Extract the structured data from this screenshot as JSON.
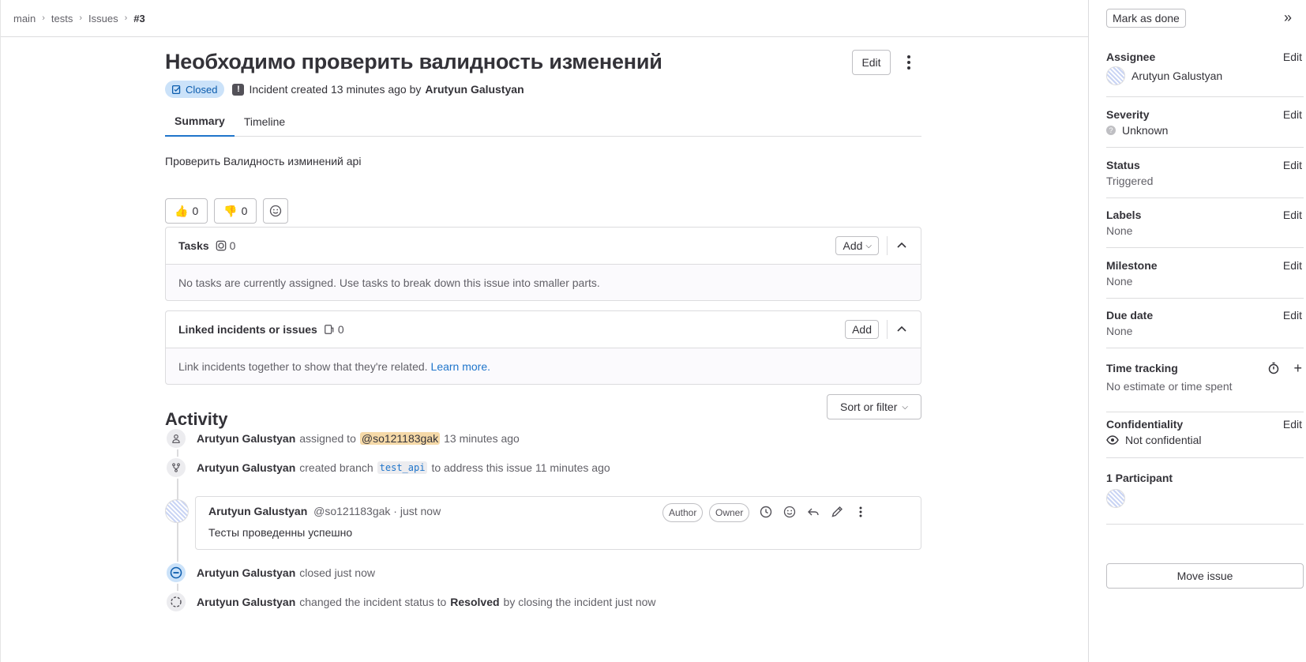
{
  "breadcrumbs": [
    "main",
    "tests",
    "Issues",
    "#3"
  ],
  "issue": {
    "title": "Необходимо проверить валидность изменений",
    "edit_label": "Edit",
    "status_badge": "Closed",
    "meta_text": "Incident created 13 minutes ago by",
    "author": "Arutyun Galustyan",
    "description": "Проверить Валидность изминений api"
  },
  "tabs": [
    {
      "label": "Summary",
      "active": true
    },
    {
      "label": "Timeline",
      "active": false
    }
  ],
  "reactions": {
    "thumbs_up": "0",
    "thumbs_down": "0"
  },
  "tasks": {
    "title": "Tasks",
    "count": "0",
    "add_label": "Add",
    "empty_text": "No tasks are currently assigned. Use tasks to break down this issue into smaller parts."
  },
  "linked": {
    "title": "Linked incidents or issues",
    "count": "0",
    "add_label": "Add",
    "empty_text": "Link incidents together to show that they're related.",
    "learn_more": "Learn more."
  },
  "activity": {
    "title": "Activity",
    "sort_label": "Sort or filter",
    "events": {
      "assigned": {
        "user": "Arutyun Galustyan",
        "action": "assigned to",
        "mention": "@so121183gak",
        "time": "13 minutes ago"
      },
      "branch": {
        "user": "Arutyun Galustyan",
        "action": "created branch",
        "branch": "test_api",
        "rest": "to address this issue 11 minutes ago"
      },
      "closed": {
        "user": "Arutyun Galustyan",
        "action": "closed just now"
      },
      "status": {
        "user": "Arutyun Galustyan",
        "action": "changed the incident status to",
        "status": "Resolved",
        "rest": "by closing the incident just now"
      }
    },
    "comment": {
      "author": "Arutyun Galustyan",
      "handle_time": "@so121183gak · just now",
      "badge_author": "Author",
      "badge_owner": "Owner",
      "body": "Тесты проведенны успешно"
    }
  },
  "sidebar": {
    "mark_done": "Mark as done",
    "edit_label": "Edit",
    "assignee": {
      "title": "Assignee",
      "value": "Arutyun Galustyan"
    },
    "severity": {
      "title": "Severity",
      "value": "Unknown"
    },
    "status": {
      "title": "Status",
      "value": "Triggered"
    },
    "labels": {
      "title": "Labels",
      "value": "None"
    },
    "milestone": {
      "title": "Milestone",
      "value": "None"
    },
    "due_date": {
      "title": "Due date",
      "value": "None"
    },
    "time_tracking": {
      "title": "Time tracking",
      "value": "No estimate or time spent"
    },
    "confidentiality": {
      "title": "Confidentiality",
      "value": "Not confidential"
    },
    "participants": {
      "title": "1 Participant"
    },
    "move_issue": "Move issue"
  }
}
